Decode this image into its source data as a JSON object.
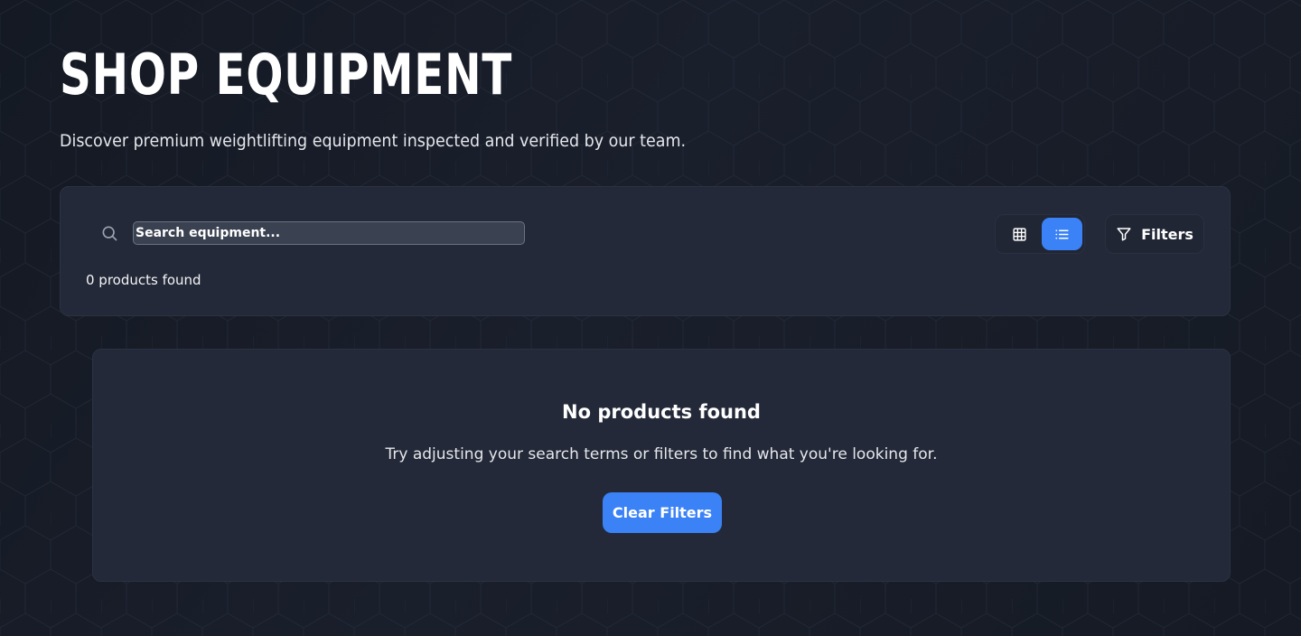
{
  "header": {
    "title": "SHOP EQUIPMENT",
    "subtitle": "Discover premium weightlifting equipment inspected and verified by our team."
  },
  "toolbar": {
    "search": {
      "icon": "search-icon",
      "placeholder": "Search equipment...",
      "value": ""
    },
    "products_count": "0 products found",
    "view_toggle": {
      "options": [
        {
          "name": "grid",
          "icon": "grid-icon",
          "active": false
        },
        {
          "name": "list",
          "icon": "list-icon",
          "active": true
        }
      ]
    },
    "filters": {
      "icon": "filter-icon",
      "label": "Filters"
    }
  },
  "empty_state": {
    "title": "No products found",
    "message": "Try adjusting your search terms or filters to find what you're looking for.",
    "action_label": "Clear Filters"
  },
  "colors": {
    "accent": "#3b82f6",
    "panel": "#232938",
    "background": "#171c27"
  }
}
